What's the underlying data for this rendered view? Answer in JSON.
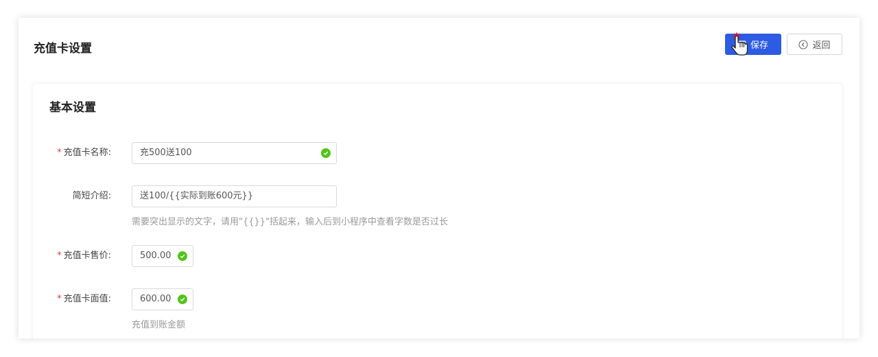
{
  "header": {
    "title": "充值卡设置",
    "save_label": "保存",
    "back_label": "返回"
  },
  "section": {
    "title": "基本设置"
  },
  "form": {
    "name": {
      "label": "充值卡名称:",
      "value": "充500送100",
      "required": true
    },
    "intro": {
      "label": "简短介绍:",
      "value": "送100/{{实际到账600元}}",
      "hint": "需要突出显示的文字，请用\"{{}}\"括起来，输入后到小程序中查看字数是否过长"
    },
    "price": {
      "label": "充值卡售价:",
      "value": "500.00",
      "required": true
    },
    "face_value": {
      "label": "充值卡面值:",
      "value": "600.00",
      "required": true,
      "hint": "充值到账金额"
    }
  },
  "colors": {
    "primary": "#2d5be3",
    "success": "#52c41a",
    "required": "#e4393c"
  },
  "icons": {
    "save": "save-icon",
    "back": "circle-chevron-left-icon",
    "valid": "check-circle-icon",
    "cursor": "hand-pointer-icon"
  }
}
